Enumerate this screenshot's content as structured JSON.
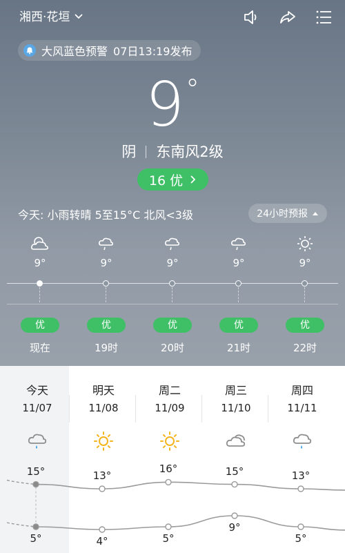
{
  "header": {
    "location": "湘西·花垣",
    "icons": [
      "speaker-icon",
      "share-icon",
      "menu-icon"
    ]
  },
  "alert": {
    "text": "大风蓝色预警",
    "time": "07日13:19发布",
    "icon": "bell-icon"
  },
  "current": {
    "temperature": "9",
    "degree_symbol": "°",
    "condition": "阴",
    "wind": "东南风2级",
    "aqi_value": "16",
    "aqi_label": "优"
  },
  "today_summary": "今天: 小雨转晴 5至15°C 北风<3级",
  "forecast_24h_label": "24小时预报",
  "hourly": [
    {
      "icon": "cloudy-icon",
      "temp": "9°",
      "quality": "优",
      "label": "现在",
      "now": true
    },
    {
      "icon": "drizzle-icon",
      "temp": "9°",
      "quality": "优",
      "label": "19时"
    },
    {
      "icon": "drizzle-icon",
      "temp": "9°",
      "quality": "优",
      "label": "20时"
    },
    {
      "icon": "drizzle-icon",
      "temp": "9°",
      "quality": "优",
      "label": "21时"
    },
    {
      "icon": "sunny-icon",
      "temp": "9°",
      "quality": "优",
      "label": "22时"
    }
  ],
  "daily": [
    {
      "name": "今天",
      "date": "11/07",
      "icon": "rain-cloud-icon",
      "high": 15,
      "low": 5,
      "high_label": "15°",
      "low_label": "5°"
    },
    {
      "name": "明天",
      "date": "11/08",
      "icon": "sun-icon",
      "high": 13,
      "low": 4,
      "high_label": "13°",
      "low_label": "4°"
    },
    {
      "name": "周二",
      "date": "11/09",
      "icon": "sun-icon",
      "high": 16,
      "low": 5,
      "high_label": "16°",
      "low_label": "5°"
    },
    {
      "name": "周三",
      "date": "11/10",
      "icon": "cloud-icon",
      "high": 15,
      "low": 9,
      "high_label": "15°",
      "low_label": "9°"
    },
    {
      "name": "周四",
      "date": "11/11",
      "icon": "rain-cloud-icon",
      "high": 13,
      "low": 5,
      "high_label": "13°",
      "low_label": "5°"
    }
  ],
  "colors": {
    "good_quality": "#3fbf66",
    "sun": "#f5b31c",
    "rain_drop": "#3aa0e8"
  }
}
